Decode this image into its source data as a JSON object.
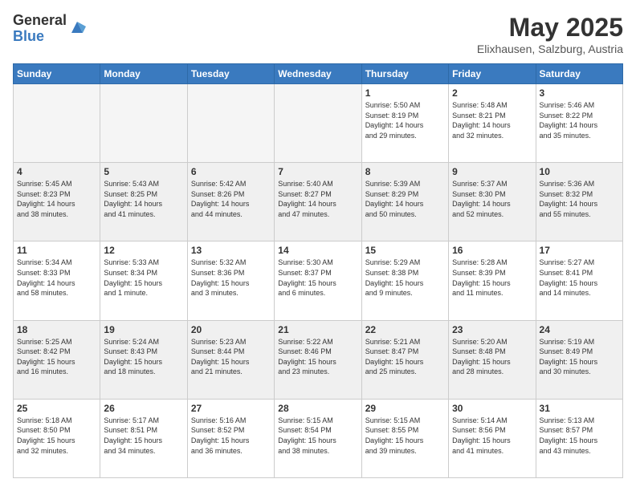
{
  "logo": {
    "general": "General",
    "blue": "Blue"
  },
  "header": {
    "month": "May 2025",
    "location": "Elixhausen, Salzburg, Austria"
  },
  "weekdays": [
    "Sunday",
    "Monday",
    "Tuesday",
    "Wednesday",
    "Thursday",
    "Friday",
    "Saturday"
  ],
  "weeks": [
    [
      {
        "day": "",
        "info": ""
      },
      {
        "day": "",
        "info": ""
      },
      {
        "day": "",
        "info": ""
      },
      {
        "day": "",
        "info": ""
      },
      {
        "day": "1",
        "info": "Sunrise: 5:50 AM\nSunset: 8:19 PM\nDaylight: 14 hours\nand 29 minutes."
      },
      {
        "day": "2",
        "info": "Sunrise: 5:48 AM\nSunset: 8:21 PM\nDaylight: 14 hours\nand 32 minutes."
      },
      {
        "day": "3",
        "info": "Sunrise: 5:46 AM\nSunset: 8:22 PM\nDaylight: 14 hours\nand 35 minutes."
      }
    ],
    [
      {
        "day": "4",
        "info": "Sunrise: 5:45 AM\nSunset: 8:23 PM\nDaylight: 14 hours\nand 38 minutes."
      },
      {
        "day": "5",
        "info": "Sunrise: 5:43 AM\nSunset: 8:25 PM\nDaylight: 14 hours\nand 41 minutes."
      },
      {
        "day": "6",
        "info": "Sunrise: 5:42 AM\nSunset: 8:26 PM\nDaylight: 14 hours\nand 44 minutes."
      },
      {
        "day": "7",
        "info": "Sunrise: 5:40 AM\nSunset: 8:27 PM\nDaylight: 14 hours\nand 47 minutes."
      },
      {
        "day": "8",
        "info": "Sunrise: 5:39 AM\nSunset: 8:29 PM\nDaylight: 14 hours\nand 50 minutes."
      },
      {
        "day": "9",
        "info": "Sunrise: 5:37 AM\nSunset: 8:30 PM\nDaylight: 14 hours\nand 52 minutes."
      },
      {
        "day": "10",
        "info": "Sunrise: 5:36 AM\nSunset: 8:32 PM\nDaylight: 14 hours\nand 55 minutes."
      }
    ],
    [
      {
        "day": "11",
        "info": "Sunrise: 5:34 AM\nSunset: 8:33 PM\nDaylight: 14 hours\nand 58 minutes."
      },
      {
        "day": "12",
        "info": "Sunrise: 5:33 AM\nSunset: 8:34 PM\nDaylight: 15 hours\nand 1 minute."
      },
      {
        "day": "13",
        "info": "Sunrise: 5:32 AM\nSunset: 8:36 PM\nDaylight: 15 hours\nand 3 minutes."
      },
      {
        "day": "14",
        "info": "Sunrise: 5:30 AM\nSunset: 8:37 PM\nDaylight: 15 hours\nand 6 minutes."
      },
      {
        "day": "15",
        "info": "Sunrise: 5:29 AM\nSunset: 8:38 PM\nDaylight: 15 hours\nand 9 minutes."
      },
      {
        "day": "16",
        "info": "Sunrise: 5:28 AM\nSunset: 8:39 PM\nDaylight: 15 hours\nand 11 minutes."
      },
      {
        "day": "17",
        "info": "Sunrise: 5:27 AM\nSunset: 8:41 PM\nDaylight: 15 hours\nand 14 minutes."
      }
    ],
    [
      {
        "day": "18",
        "info": "Sunrise: 5:25 AM\nSunset: 8:42 PM\nDaylight: 15 hours\nand 16 minutes."
      },
      {
        "day": "19",
        "info": "Sunrise: 5:24 AM\nSunset: 8:43 PM\nDaylight: 15 hours\nand 18 minutes."
      },
      {
        "day": "20",
        "info": "Sunrise: 5:23 AM\nSunset: 8:44 PM\nDaylight: 15 hours\nand 21 minutes."
      },
      {
        "day": "21",
        "info": "Sunrise: 5:22 AM\nSunset: 8:46 PM\nDaylight: 15 hours\nand 23 minutes."
      },
      {
        "day": "22",
        "info": "Sunrise: 5:21 AM\nSunset: 8:47 PM\nDaylight: 15 hours\nand 25 minutes."
      },
      {
        "day": "23",
        "info": "Sunrise: 5:20 AM\nSunset: 8:48 PM\nDaylight: 15 hours\nand 28 minutes."
      },
      {
        "day": "24",
        "info": "Sunrise: 5:19 AM\nSunset: 8:49 PM\nDaylight: 15 hours\nand 30 minutes."
      }
    ],
    [
      {
        "day": "25",
        "info": "Sunrise: 5:18 AM\nSunset: 8:50 PM\nDaylight: 15 hours\nand 32 minutes."
      },
      {
        "day": "26",
        "info": "Sunrise: 5:17 AM\nSunset: 8:51 PM\nDaylight: 15 hours\nand 34 minutes."
      },
      {
        "day": "27",
        "info": "Sunrise: 5:16 AM\nSunset: 8:52 PM\nDaylight: 15 hours\nand 36 minutes."
      },
      {
        "day": "28",
        "info": "Sunrise: 5:15 AM\nSunset: 8:54 PM\nDaylight: 15 hours\nand 38 minutes."
      },
      {
        "day": "29",
        "info": "Sunrise: 5:15 AM\nSunset: 8:55 PM\nDaylight: 15 hours\nand 39 minutes."
      },
      {
        "day": "30",
        "info": "Sunrise: 5:14 AM\nSunset: 8:56 PM\nDaylight: 15 hours\nand 41 minutes."
      },
      {
        "day": "31",
        "info": "Sunrise: 5:13 AM\nSunset: 8:57 PM\nDaylight: 15 hours\nand 43 minutes."
      }
    ]
  ]
}
